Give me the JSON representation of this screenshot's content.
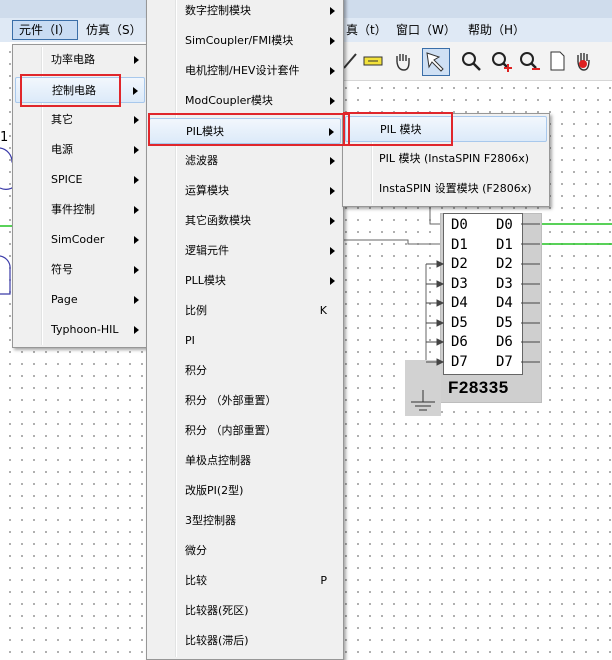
{
  "menubar": {
    "items": [
      {
        "label": "元件（I）"
      },
      {
        "label": "仿真（S）"
      },
      {
        "label": "真（t）"
      },
      {
        "label": "窗口（W）"
      },
      {
        "label": "帮助（H）"
      }
    ]
  },
  "menu_element": {
    "items": [
      {
        "label": "功率电路"
      },
      {
        "label": "控制电路"
      },
      {
        "label": "其它"
      },
      {
        "label": "电源"
      },
      {
        "label": "SPICE"
      },
      {
        "label": "事件控制"
      },
      {
        "label": "SimCoder"
      },
      {
        "label": "符号"
      },
      {
        "label": "Page"
      },
      {
        "label": "Typhoon-HIL"
      }
    ]
  },
  "menu_control": {
    "items": [
      {
        "label": "数字控制模块",
        "key": ""
      },
      {
        "label": "SimCoupler/FMI模块",
        "key": ""
      },
      {
        "label": "电机控制/HEV设计套件",
        "key": ""
      },
      {
        "label": "ModCoupler模块",
        "key": ""
      },
      {
        "label": "PIL模块",
        "key": ""
      },
      {
        "label": "滤波器",
        "key": ""
      },
      {
        "label": "运算模块",
        "key": ""
      },
      {
        "label": "其它函数模块",
        "key": ""
      },
      {
        "label": "逻辑元件",
        "key": ""
      },
      {
        "label": "PLL模块",
        "key": ""
      },
      {
        "label": "比例",
        "key": "K"
      },
      {
        "label": "PI",
        "key": ""
      },
      {
        "label": "积分",
        "key": ""
      },
      {
        "label": "积分 （外部重置）",
        "key": ""
      },
      {
        "label": "积分 （内部重置）",
        "key": ""
      },
      {
        "label": "单极点控制器",
        "key": ""
      },
      {
        "label": "改版PI(2型)",
        "key": ""
      },
      {
        "label": "3型控制器",
        "key": ""
      },
      {
        "label": "微分",
        "key": ""
      },
      {
        "label": "比较",
        "key": "P"
      },
      {
        "label": "比较器(死区)",
        "key": ""
      },
      {
        "label": "比较器(滞后)",
        "key": ""
      }
    ]
  },
  "menu_pil": {
    "items": [
      {
        "label": "PIL 模块"
      },
      {
        "label": "PIL 模块 (InstaSPIN F2806x)"
      },
      {
        "label": "InstaSPIN 设置模块 (F2806x)"
      }
    ]
  },
  "schematic": {
    "chip_name": "F28335",
    "left_pins": [
      "D0",
      "D1",
      "D2",
      "D3",
      "D4",
      "D5",
      "D6",
      "D7"
    ],
    "right_pins": [
      "D0",
      "D1",
      "D2",
      "D3",
      "D4",
      "D5",
      "D6",
      "D7"
    ],
    "left_label": "1"
  },
  "colors": {
    "highlight_box": "#e0262b",
    "menu_bg": "#f0f0f0",
    "wire_green": "#22c222"
  }
}
